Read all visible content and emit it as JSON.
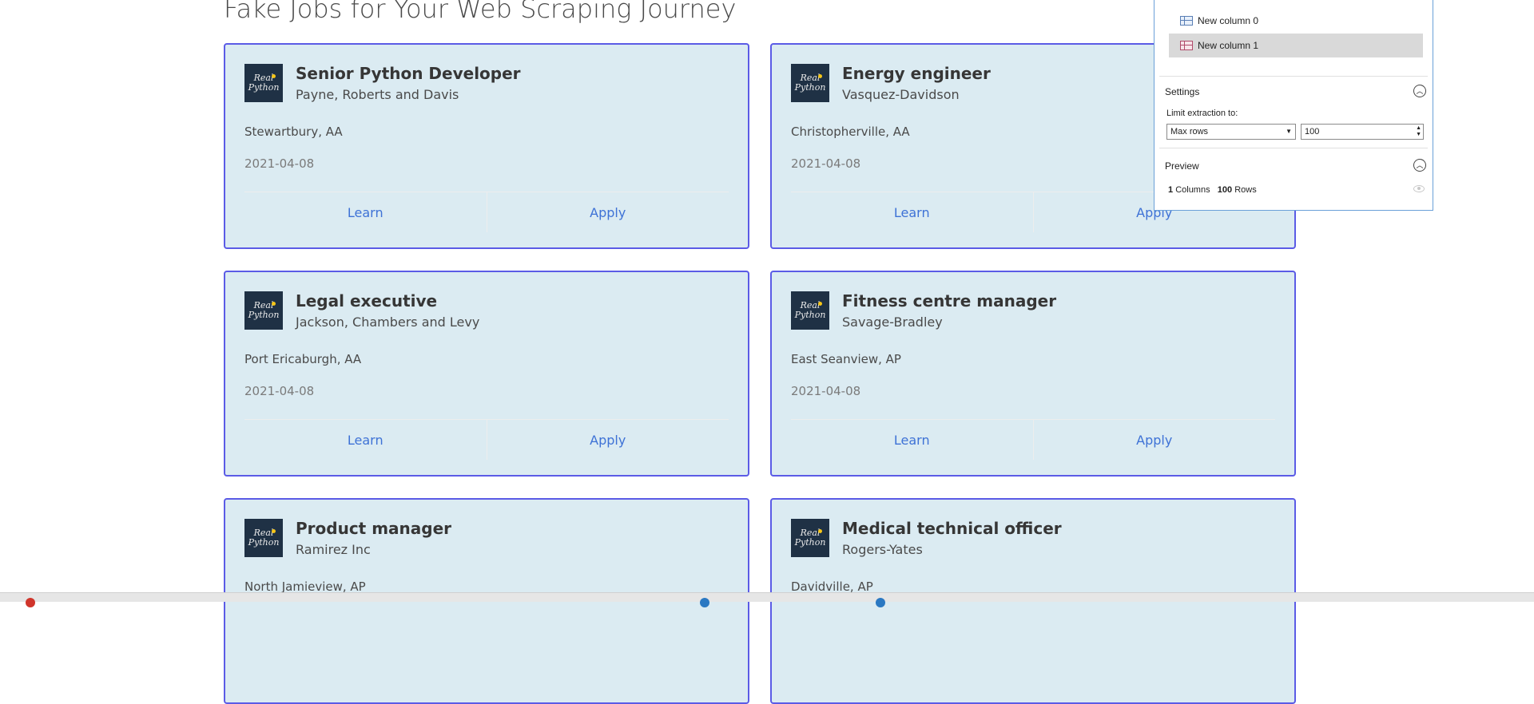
{
  "page": {
    "title": "Fake Jobs for Your Web Scraping Journey"
  },
  "logo": {
    "line1": "Real",
    "line2": "Python"
  },
  "jobs": [
    {
      "title": "Senior Python Developer",
      "company": "Payne, Roberts and Davis",
      "location": "Stewartbury, AA",
      "date": "2021-04-08",
      "learn": "Learn",
      "apply": "Apply"
    },
    {
      "title": "Energy engineer",
      "company": "Vasquez-Davidson",
      "location": "Christopherville, AA",
      "date": "2021-04-08",
      "learn": "Learn",
      "apply": "Apply"
    },
    {
      "title": "Legal executive",
      "company": "Jackson, Chambers and Levy",
      "location": "Port Ericaburgh, AA",
      "date": "2021-04-08",
      "learn": "Learn",
      "apply": "Apply"
    },
    {
      "title": "Fitness centre manager",
      "company": "Savage-Bradley",
      "location": "East Seanview, AP",
      "date": "2021-04-08",
      "learn": "Learn",
      "apply": "Apply"
    },
    {
      "title": "Product manager",
      "company": "Ramirez Inc",
      "location": "North Jamieview, AP",
      "date": "",
      "learn": "",
      "apply": ""
    },
    {
      "title": "Medical technical officer",
      "company": "Rogers-Yates",
      "location": "Davidville, AP",
      "date": "",
      "learn": "",
      "apply": ""
    }
  ],
  "panel": {
    "columns": [
      "New column 0",
      "New column 1"
    ],
    "settings_label": "Settings",
    "limit_label": "Limit extraction to:",
    "limit_mode": "Max rows",
    "limit_value": "100",
    "preview_label": "Preview",
    "preview_columns": "1",
    "preview_columns_label": "Columns",
    "preview_rows": "100",
    "preview_rows_label": "Rows"
  }
}
